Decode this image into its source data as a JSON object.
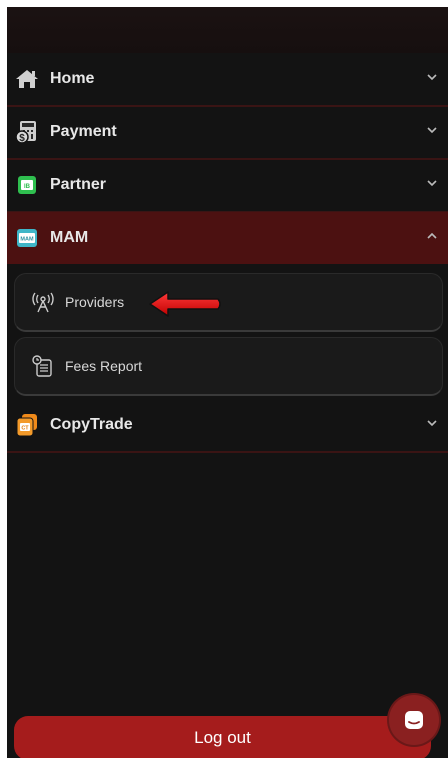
{
  "menu": {
    "items": [
      {
        "label": "Home",
        "icon": "home-icon"
      },
      {
        "label": "Payment",
        "icon": "payment-icon"
      },
      {
        "label": "Partner",
        "icon": "partner-icon"
      },
      {
        "label": "MAM",
        "icon": "mam-icon",
        "expanded": true
      },
      {
        "label": "CopyTrade",
        "icon": "copytrade-icon"
      }
    ],
    "mam_submenu": [
      {
        "label": "Providers",
        "icon": "broadcast-tower-icon"
      },
      {
        "label": "Fees Report",
        "icon": "report-icon"
      }
    ],
    "partner_badge": "IB",
    "mam_badge": "MAM",
    "copytrade_badge": "CT"
  },
  "logout_label": "Log out",
  "colors": {
    "background": "#131313",
    "active_item": "#4c1111",
    "logout_button": "#a51c1c",
    "annotation_arrow": "#e01010"
  }
}
